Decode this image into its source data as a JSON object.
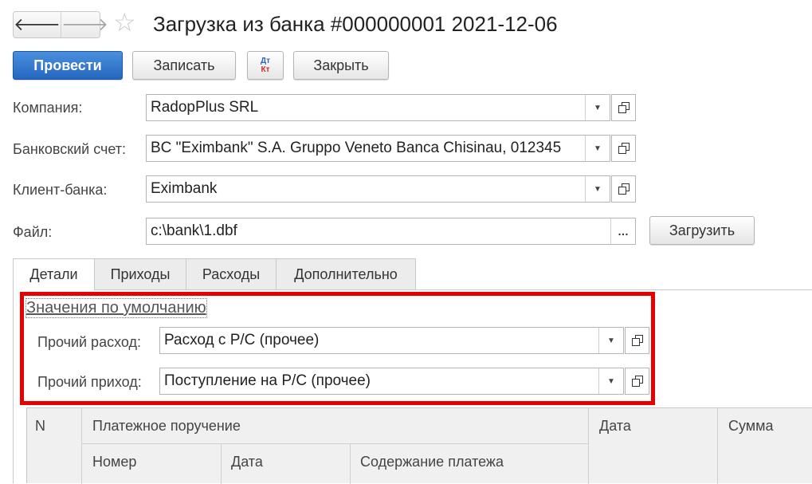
{
  "header": {
    "back_icon": "arrow-left-icon",
    "forward_icon": "arrow-right-icon",
    "favorite_icon": "star-icon",
    "title": "Загрузка из банка #000000001 2021-12-06"
  },
  "toolbar": {
    "post_label": "Провести",
    "save_label": "Записать",
    "dtkt_top": "Дт",
    "dtkt_bottom": "Кт",
    "close_label": "Закрыть"
  },
  "form": {
    "company_label": "Компания:",
    "company_value": "RadopPlus SRL",
    "account_label": "Банковский счет:",
    "account_value": "BC \"Eximbank\" S.A. Gruppo Veneto Banca Chisinau, 012345",
    "client_bank_label": "Клиент-банка:",
    "client_bank_value": "Eximbank",
    "file_label": "Файл:",
    "file_value": "c:\\bank\\1.dbf",
    "load_label": "Загрузить"
  },
  "tabs": [
    {
      "label": "Детали",
      "active": true
    },
    {
      "label": "Приходы",
      "active": false
    },
    {
      "label": "Расходы",
      "active": false
    },
    {
      "label": "Дополнительно",
      "active": false
    }
  ],
  "defaults": {
    "group_title": "Значения по умолчанию",
    "other_expense_label": "Прочий расход:",
    "other_expense_value": "Расход с Р/С  (прочее)",
    "other_income_label": "Прочий приход:",
    "other_income_value": "Поступление на Р/С (прочее)"
  },
  "table": {
    "col_n": "N",
    "col_payment_order": "Платежное поручение",
    "col_number": "Номер",
    "col_date_sub": "Дата",
    "col_content": "Содержание платежа",
    "col_date": "Дата",
    "col_sum": "Сумма"
  },
  "colors": {
    "primary_button": "#2566c0",
    "highlight_border": "#e60000"
  }
}
